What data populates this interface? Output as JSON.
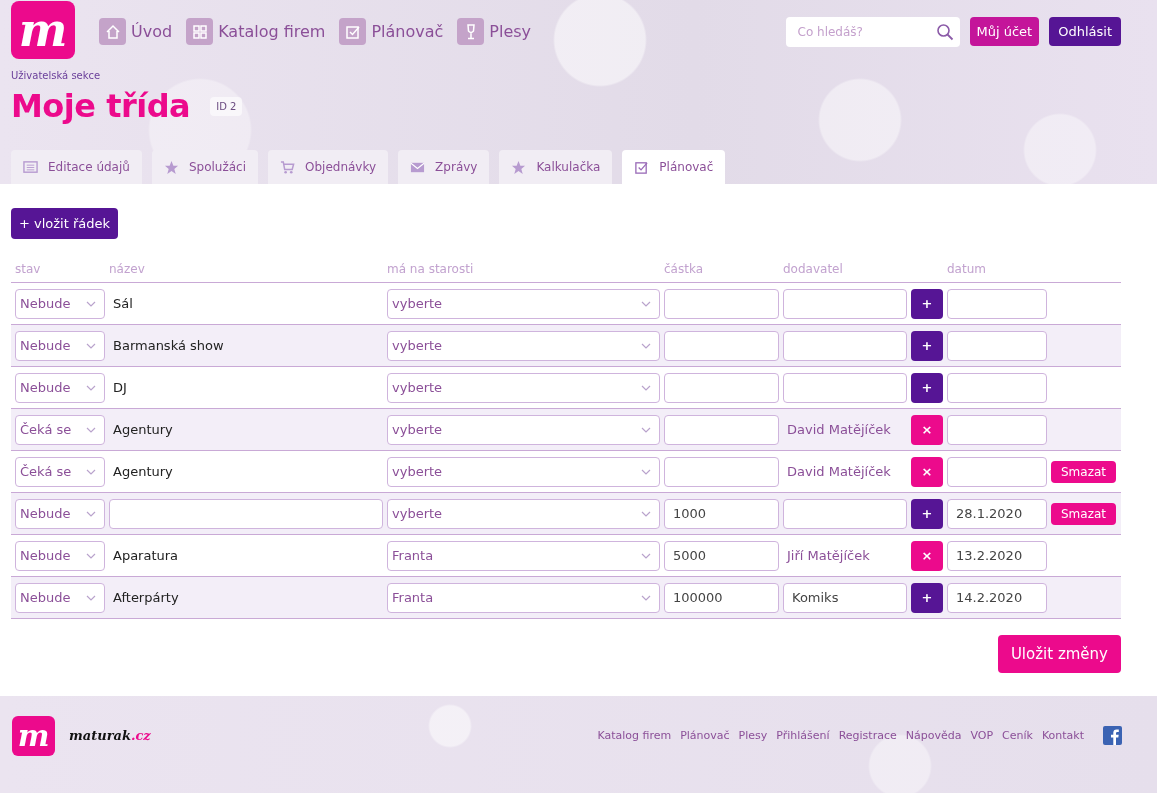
{
  "logo": {
    "mark": "m"
  },
  "nav": [
    {
      "label": "Úvod"
    },
    {
      "label": "Katalog firem"
    },
    {
      "label": "Plánovač"
    },
    {
      "label": "Plesy"
    }
  ],
  "search": {
    "placeholder": "Co hledáš?"
  },
  "account_button": "Můj účet",
  "logout_button": "Odhlásit",
  "breadcrumb": "Uživatelská sekce",
  "page_title": "Moje třída",
  "id_badge": "ID 2",
  "tabs": [
    {
      "label": "Editace údajů",
      "selected": false
    },
    {
      "label": "Spolužáci",
      "selected": false
    },
    {
      "label": "Objednávky",
      "selected": false
    },
    {
      "label": "Zprávy",
      "selected": false
    },
    {
      "label": "Kalkulačka",
      "selected": false
    },
    {
      "label": "Plánovač",
      "selected": true
    }
  ],
  "add_row_button": "+ vložit řádek",
  "table": {
    "columns": [
      "stav",
      "název",
      "má na starosti",
      "částka",
      "dodavatel",
      "datum"
    ],
    "rows": [
      {
        "status": "Nebude",
        "name": {
          "kind": "text",
          "text": "Sál"
        },
        "assignee": "vyberte",
        "supplier": {
          "kind": "input"
        },
        "action": {
          "kind": "add",
          "label": "+"
        }
      },
      {
        "status": "Nebude",
        "name": {
          "kind": "text",
          "text": "Barmanská show"
        },
        "assignee": "vyberte",
        "supplier": {
          "kind": "input"
        },
        "action": {
          "kind": "add",
          "label": "+"
        }
      },
      {
        "status": "Nebude",
        "name": {
          "kind": "text",
          "text": "DJ"
        },
        "assignee": "vyberte",
        "supplier": {
          "kind": "input"
        },
        "action": {
          "kind": "add",
          "label": "+"
        }
      },
      {
        "status": "Čeká se",
        "name": {
          "kind": "text",
          "text": "Agentury"
        },
        "assignee": "vyberte",
        "supplier": {
          "kind": "text",
          "text": "David Matějíček"
        },
        "action": {
          "kind": "remove",
          "label": "×"
        }
      },
      {
        "status": "Čeká se",
        "name": {
          "kind": "text",
          "text": "Agentury"
        },
        "assignee": "vyberte",
        "supplier": {
          "kind": "text",
          "text": "David Matějíček"
        },
        "action": {
          "kind": "remove",
          "label": "×"
        },
        "delete_label": "Smazat"
      },
      {
        "status": "Nebude",
        "name": {
          "kind": "input"
        },
        "assignee": "vyberte",
        "amount": "1000",
        "supplier": {
          "kind": "input"
        },
        "action": {
          "kind": "add",
          "label": "+"
        },
        "date": "28.1.2020",
        "delete_label": "Smazat"
      },
      {
        "status": "Nebude",
        "name": {
          "kind": "text",
          "text": "Aparatura"
        },
        "assignee": "Franta",
        "amount": "5000",
        "supplier": {
          "kind": "text",
          "text": "Jiří Matějíček"
        },
        "action": {
          "kind": "remove",
          "label": "×"
        },
        "date": "13.2.2020"
      },
      {
        "status": "Nebude",
        "name": {
          "kind": "text",
          "text": "Afterpárty"
        },
        "assignee": "Franta",
        "amount": "100000",
        "supplier": {
          "kind": "input",
          "text": "Komiks"
        },
        "action": {
          "kind": "add",
          "label": "+"
        },
        "date": "14.2.2020"
      }
    ]
  },
  "save_button": "Uložit změny",
  "footer": {
    "logo_mark": "m",
    "brand_name": "maturak",
    "brand_tld": ".cz",
    "links": [
      "Katalog firem",
      "Plánovač",
      "Plesy",
      "Přihlášení",
      "Registrace",
      "Nápověda",
      "VOP",
      "Ceník",
      "Kontakt"
    ]
  }
}
